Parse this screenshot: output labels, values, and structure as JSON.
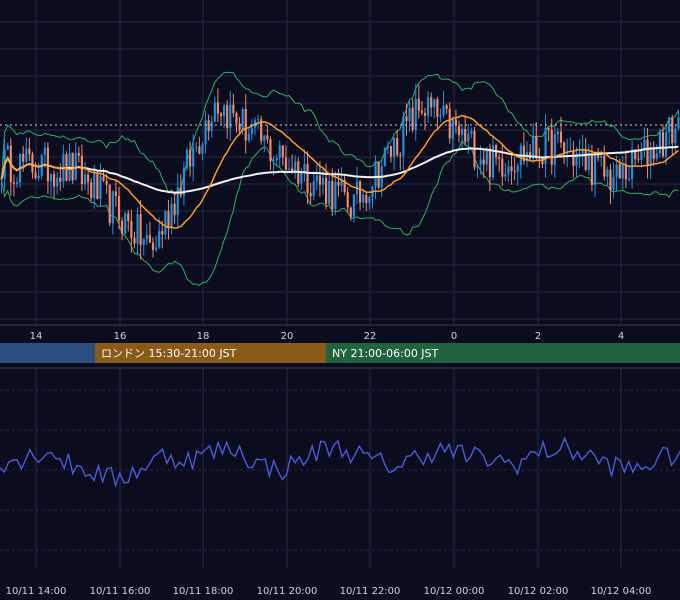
{
  "colors": {
    "background": "#0b0c1e",
    "grid": "#252a44",
    "candle_up": "#1e90e0",
    "candle_down": "#f08a6a",
    "ma_short": "#ff9a2a",
    "ma_long": "#f2f2f2",
    "bollinger": "#2fae62",
    "oscillator": "#4b5bd6",
    "session_tokyo": "#2a4f80",
    "session_london": "#8a5a18",
    "session_ny": "#22633f"
  },
  "chart_data": [
    {
      "type": "candlestick",
      "x_axis_ticks": [
        "14",
        "16",
        "18",
        "20",
        "22",
        "0",
        "2",
        "4"
      ],
      "y_range": [
        0,
        100
      ],
      "reference_level": 70,
      "start_level": 55,
      "segments": [
        {
          "bars": 25,
          "to": 52
        },
        {
          "bars": 25,
          "to": 20
        },
        {
          "bars": 20,
          "to": 80
        },
        {
          "bars": 20,
          "to": 58
        },
        {
          "bars": 25,
          "to": 38
        },
        {
          "bars": 22,
          "to": 78
        },
        {
          "bars": 23,
          "to": 55
        },
        {
          "bars": 20,
          "to": 62
        },
        {
          "bars": 20,
          "to": 48
        },
        {
          "bars": 20,
          "to": 70
        }
      ],
      "indicators": [
        "ma-short",
        "ma-long",
        "bollinger-bands"
      ]
    },
    {
      "type": "line",
      "x_axis_ticks": [
        "10/11 14:00",
        "10/11 16:00",
        "10/11 18:00",
        "10/11 20:00",
        "10/11 22:00",
        "10/12 00:00",
        "10/12 02:00",
        "10/12 04:00"
      ],
      "y_range": [
        0,
        100
      ],
      "series": [
        {
          "values": [
            48,
            52,
            60,
            45,
            38,
            30,
            42,
            55,
            50,
            58,
            62,
            46,
            40,
            52,
            64,
            58,
            48,
            44,
            56,
            60,
            54,
            50,
            46,
            58,
            62,
            55,
            45,
            40,
            50,
            57
          ]
        }
      ]
    }
  ],
  "sessions": [
    {
      "label": "",
      "color": "#2a4f80"
    },
    {
      "label": "ロンドン 15:30-21:00 JST",
      "color": "#8a5a18"
    },
    {
      "label": "NY 21:00-06:00 JST",
      "color": "#22633f"
    }
  ]
}
